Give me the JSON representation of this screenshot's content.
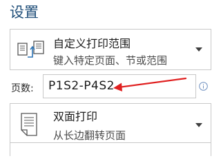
{
  "section_title": "设置",
  "print_range": {
    "title": "自定义打印范围",
    "subtitle": "键入特定页面、节或范围",
    "icon": "custom-range-icon"
  },
  "pages": {
    "label": "页数:",
    "value": "P1S2-P4S2",
    "info_icon": "info-icon"
  },
  "duplex": {
    "title": "双面打印",
    "subtitle": "从长边翻转页面",
    "icon": "duplex-icon"
  },
  "colors": {
    "title": "#1f4e79",
    "arrow": "#e02020",
    "info": "#6c8ebf"
  }
}
